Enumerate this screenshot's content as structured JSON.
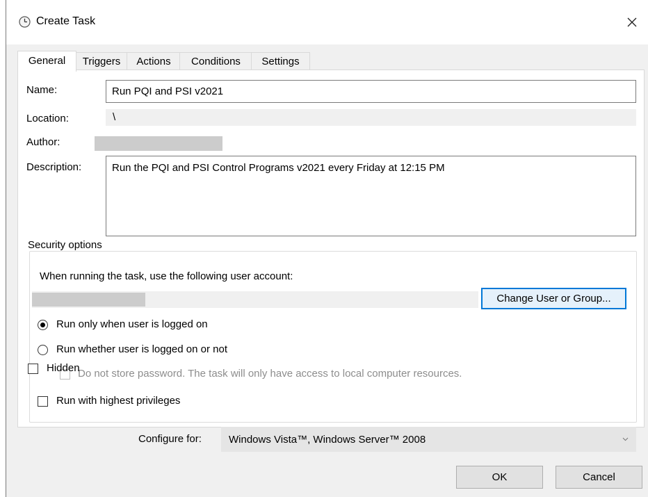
{
  "window": {
    "title": "Create Task",
    "close_symbol": "✕"
  },
  "tabs": [
    {
      "label": "General",
      "active": true
    },
    {
      "label": "Triggers",
      "active": false
    },
    {
      "label": "Actions",
      "active": false
    },
    {
      "label": "Conditions",
      "active": false
    },
    {
      "label": "Settings",
      "active": false
    }
  ],
  "general": {
    "name_label": "Name:",
    "name_value": "Run PQI and PSI v2021",
    "location_label": "Location:",
    "location_value": "\\",
    "author_label": "Author:",
    "description_label": "Description:",
    "description_value": "Run the PQI and PSI Control Programs v2021 every Friday at 12:15 PM"
  },
  "security": {
    "legend": "Security options",
    "account_prompt": "When running the task, use the following user account:",
    "change_button": "Change User or Group...",
    "radio_logged_on": {
      "label": "Run only when user is logged on",
      "selected": true
    },
    "radio_whether": {
      "label": "Run whether user is logged on or not",
      "selected": false
    },
    "no_store_password": {
      "label": "Do not store password.  The task will only have access to local computer resources.",
      "checked": false,
      "enabled": false
    },
    "highest_privileges": {
      "label": "Run with highest privileges",
      "checked": false
    }
  },
  "hidden": {
    "label": "Hidden",
    "checked": false
  },
  "configure": {
    "label": "Configure for:",
    "value": "Windows Vista™, Windows Server™ 2008"
  },
  "buttons": {
    "ok": "OK",
    "cancel": "Cancel"
  }
}
